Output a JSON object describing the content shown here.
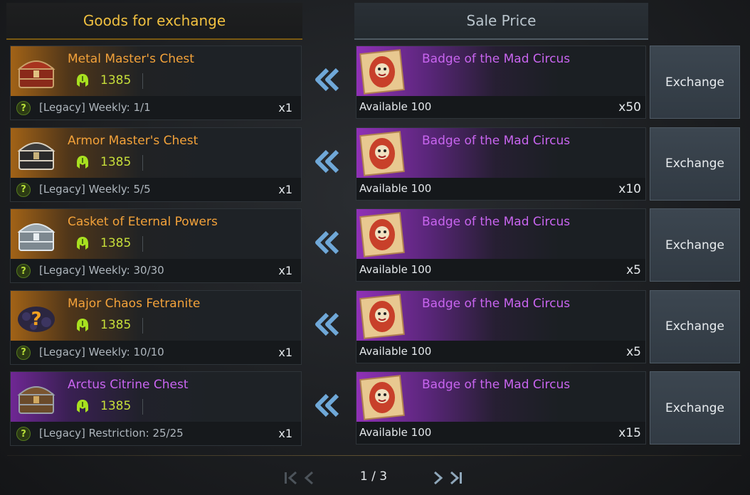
{
  "headers": {
    "goods": "Goods for exchange",
    "sale": "Sale Price"
  },
  "colors": {
    "orange_name": "#f3a23a",
    "purple_name": "#c965f0",
    "price_green": "#c7de3a",
    "header_gold": "#f0c040"
  },
  "rows": [
    {
      "item_name": "Metal Master's Chest",
      "rarity": "orange",
      "icon": "red-chest-icon",
      "price": "1385",
      "limit": "[Legacy] Weekly: 1/1",
      "qty": "x1",
      "badge_name": "Badge of the Mad Circus",
      "available": "Available 100",
      "cost_qty": "x50",
      "button": "Exchange"
    },
    {
      "item_name": "Armor Master's Chest",
      "rarity": "orange",
      "icon": "dark-chest-icon",
      "price": "1385",
      "limit": "[Legacy] Weekly: 5/5",
      "qty": "x1",
      "badge_name": "Badge of the Mad Circus",
      "available": "Available 100",
      "cost_qty": "x10",
      "button": "Exchange"
    },
    {
      "item_name": "Casket of Eternal Powers",
      "rarity": "orange",
      "icon": "silver-casket-icon",
      "price": "1385",
      "limit": "[Legacy] Weekly: 30/30",
      "qty": "x1",
      "badge_name": "Badge of the Mad Circus",
      "available": "Available 100",
      "cost_qty": "x5",
      "button": "Exchange"
    },
    {
      "item_name": "Major Chaos Fetranite",
      "rarity": "orange",
      "icon": "chaos-fetranite-icon",
      "price": "1385",
      "limit": "[Legacy] Weekly: 10/10",
      "qty": "x1",
      "badge_name": "Badge of the Mad Circus",
      "available": "Available 100",
      "cost_qty": "x5",
      "button": "Exchange"
    },
    {
      "item_name": "Arctus Citrine Chest",
      "rarity": "purple",
      "icon": "bronze-chest-icon",
      "price": "1385",
      "limit": "[Legacy] Restriction: 25/25",
      "qty": "x1",
      "badge_name": "Badge of the Mad Circus",
      "available": "Available 100",
      "cost_qty": "x15",
      "button": "Exchange"
    }
  ],
  "pagination": {
    "page": "1 / 3",
    "current": 1,
    "total": 3
  }
}
